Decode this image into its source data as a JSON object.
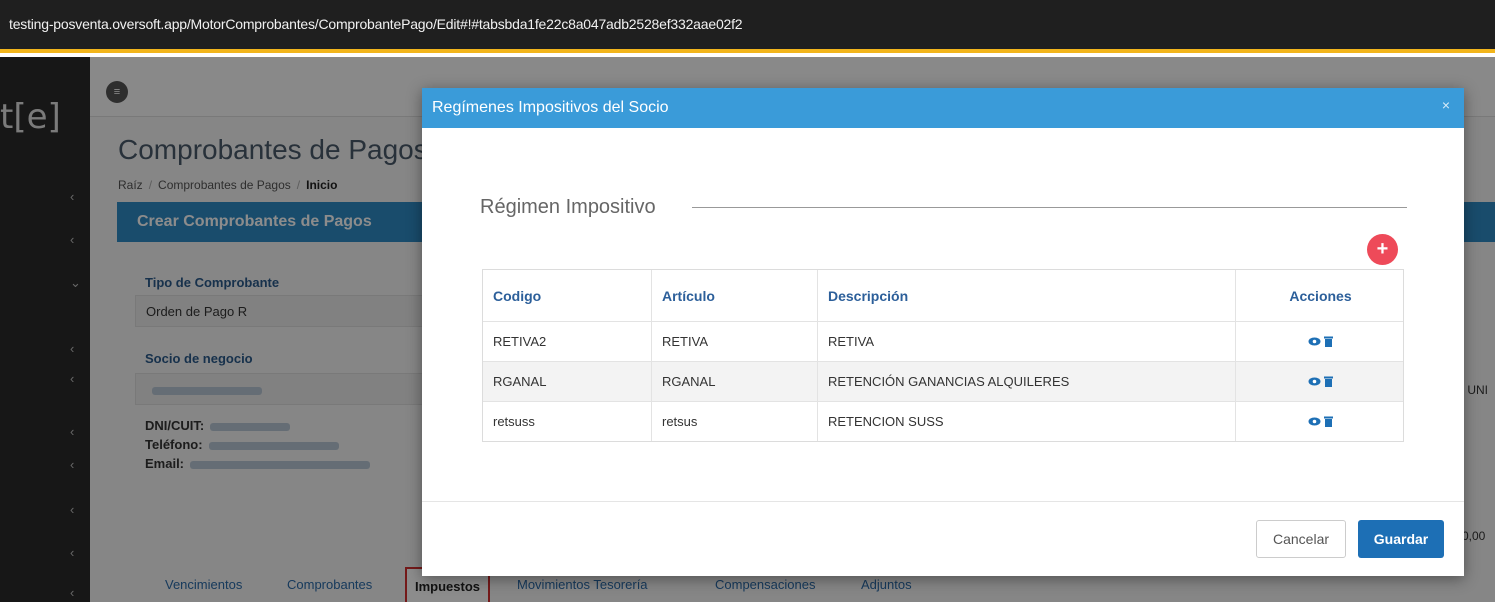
{
  "browser": {
    "url": "testing-posventa.oversoft.app/MotorComprobantes/ComprobantePago/Edit#!#tabsbda1fe22c8a047adb2528ef332aae02f2"
  },
  "app": {
    "logo": "t[e]",
    "page_title": "Comprobantes de Pagos",
    "breadcrumb": [
      "Raíz",
      "Comprobantes de Pagos",
      "Inicio"
    ],
    "panel_title": "Crear Comprobantes de Pagos",
    "tipo_label": "Tipo de Comprobante",
    "tipo_value": "Orden de Pago R",
    "socio_label": "Socio de negocio",
    "dni_label": "DNI/CUIT:",
    "telefono_label": "Teléfono:",
    "email_label": "Email:",
    "right_fragment_1": "- UNI",
    "right_fragment_2": "0,00",
    "tabs": [
      "Vencimientos",
      "Comprobantes",
      "Impuestos",
      "Movimientos Tesorería",
      "Compensaciones",
      "Adjuntos"
    ],
    "active_tab": "Impuestos"
  },
  "modal": {
    "title": "Regímenes Impositivos del Socio",
    "close": "×",
    "section_title": "Régimen Impositivo",
    "add_icon": "plus-icon",
    "columns": [
      "Codigo",
      "Artículo",
      "Descripción",
      "Acciones"
    ],
    "rows": [
      {
        "codigo": "RETIVA2",
        "articulo": "RETIVA",
        "descripcion": "RETIVA"
      },
      {
        "codigo": "RGANAL",
        "articulo": "RGANAL",
        "descripcion": "RETENCIÓN GANANCIAS ALQUILERES"
      },
      {
        "codigo": "retsuss",
        "articulo": "retsus",
        "descripcion": "RETENCION SUSS"
      }
    ],
    "row_actions": [
      "eye-icon",
      "trash-icon"
    ],
    "cancel_label": "Cancelar",
    "save_label": "Guardar"
  },
  "colors": {
    "modal_header": "#3a9bd9",
    "save_button": "#1d6fb5",
    "add_button": "#ee4a59",
    "url_accent": "#f2b51c"
  }
}
